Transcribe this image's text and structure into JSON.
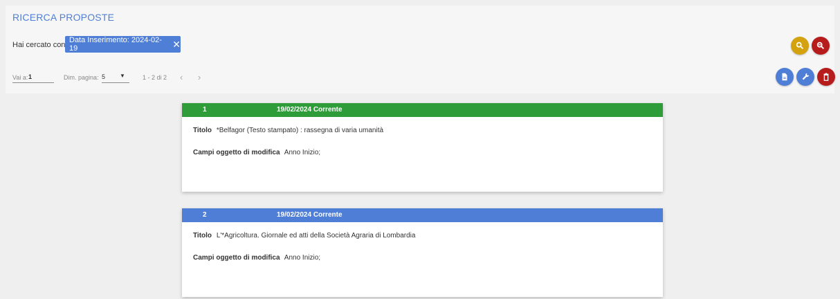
{
  "page": {
    "title": "RICERCA PROPOSTE",
    "search_label": "Hai cercato con:",
    "filter_chip": "Data Inserimento: 2024-02-19"
  },
  "pager": {
    "goto_label": "Vai a:",
    "goto_value": "1",
    "size_label": "Dim. pagina:",
    "size_value": "5",
    "range_text": "1 - 2 di 2"
  },
  "actions": {
    "search_color": "#d4a20f",
    "reset_search_color": "#b71c1c",
    "document_color": "#4f7ed6",
    "settings_color": "#4f7ed6",
    "delete_color": "#b71c1c"
  },
  "cards": [
    {
      "number": "1",
      "status": "19/02/2024 Corrente",
      "header_color": "#2e9c39",
      "title_label": "Titolo",
      "title_value": "*Belfagor (Testo stampato) : rassegna di varia umanità",
      "fields_label": "Campi oggetto di modifica",
      "fields_value": "Anno Inizio;"
    },
    {
      "number": "2",
      "status": "19/02/2024 Corrente",
      "header_color": "#4f7ed6",
      "title_label": "Titolo",
      "title_value": "L'*Agricoltura. Giornale ed atti della Società Agraria di Lombardia",
      "fields_label": "Campi oggetto di modifica",
      "fields_value": "Anno Inizio;"
    }
  ]
}
